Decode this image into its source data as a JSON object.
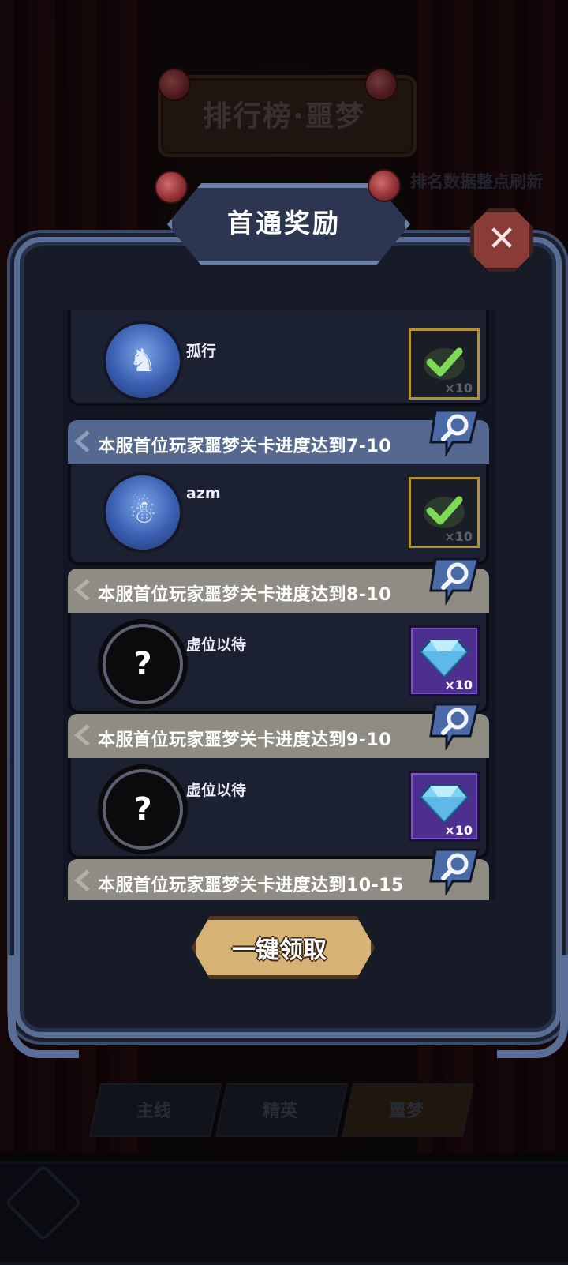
{
  "background": {
    "title": "排行榜·噩梦",
    "refresh_note": "排名数据整点刷新",
    "tabs": [
      {
        "label": "主线",
        "active": false
      },
      {
        "label": "精英",
        "active": false
      },
      {
        "label": "噩梦",
        "active": true
      }
    ]
  },
  "modal": {
    "title": "首通奖励",
    "close_icon": "close-icon",
    "collect_all_label": "一键领取"
  },
  "entries": [
    {
      "requirement": "",
      "player": "孤行",
      "avatar": "blue-dragon-helmet",
      "reward": {
        "type": "claimed",
        "count": "×10"
      }
    },
    {
      "requirement": "本服首位玩家噩梦关卡进度达到7-10",
      "player": "azm",
      "avatar": "robot-diver",
      "reward": {
        "type": "claimed",
        "count": "×10"
      }
    },
    {
      "requirement": "本服首位玩家噩梦关卡进度达到8-10",
      "player": "虚位以待",
      "avatar": "unknown",
      "reward": {
        "type": "diamond",
        "count": "×10"
      }
    },
    {
      "requirement": "本服首位玩家噩梦关卡进度达到9-10",
      "player": "虚位以待",
      "avatar": "unknown",
      "reward": {
        "type": "diamond",
        "count": "×10"
      }
    },
    {
      "requirement": "本服首位玩家噩梦关卡进度达到10-15",
      "player": "",
      "avatar": "",
      "reward": {
        "type": "",
        "count": ""
      }
    }
  ],
  "colors": {
    "frame": "#5a6d94",
    "header_achieved": "#55688f",
    "header_pending": "#8f8c84",
    "collect_button": "#d6b274",
    "close_button": "#8a3b36"
  }
}
